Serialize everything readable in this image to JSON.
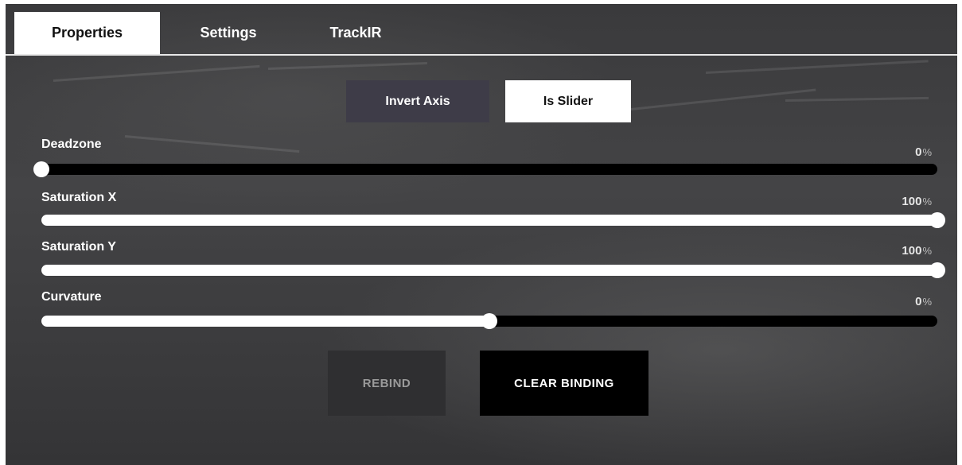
{
  "tabs": [
    {
      "label": "Properties",
      "active": true
    },
    {
      "label": "Settings",
      "active": false
    },
    {
      "label": "TrackIR",
      "active": false
    }
  ],
  "toggles": {
    "invert_axis": {
      "label": "Invert Axis",
      "selected": false
    },
    "is_slider": {
      "label": "Is Slider",
      "selected": true
    }
  },
  "sliders": [
    {
      "label": "Deadzone",
      "value": "0",
      "unit": "%",
      "level": 0.0
    },
    {
      "label": "Saturation X",
      "value": "100",
      "unit": "%",
      "level": 1.0
    },
    {
      "label": "Saturation Y",
      "value": "100",
      "unit": "%",
      "level": 1.0
    },
    {
      "label": "Curvature",
      "value": "0",
      "unit": "%",
      "level": 0.5
    }
  ],
  "buttons": {
    "rebind": "REBIND",
    "clear_binding": "CLEAR BINDING"
  },
  "colors": {
    "background": "#3f3f41",
    "track": "#000000",
    "fill": "#ffffff",
    "active_tab": "#ffffff",
    "invert_axis_bg": "#3e3c48",
    "rebind_bg": "#2f2f31",
    "clear_binding_bg": "#000000"
  }
}
